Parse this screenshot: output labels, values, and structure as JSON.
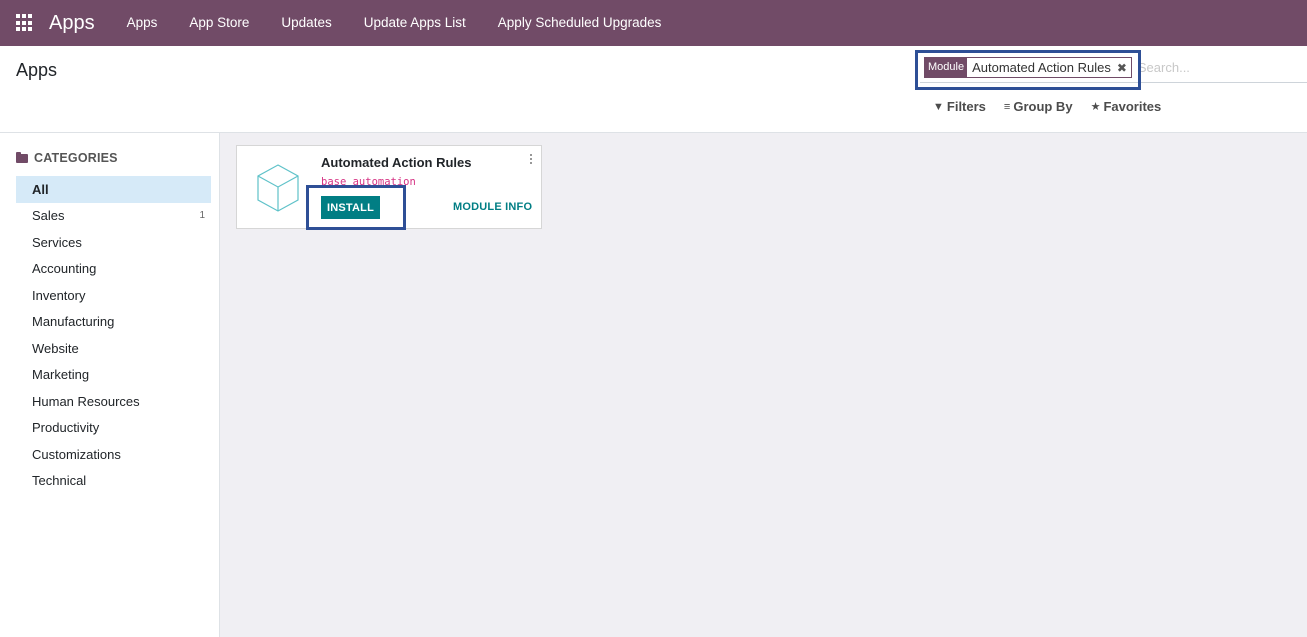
{
  "navbar": {
    "brand": "Apps",
    "items": [
      {
        "label": "Apps"
      },
      {
        "label": "App Store"
      },
      {
        "label": "Updates"
      },
      {
        "label": "Update Apps List"
      },
      {
        "label": "Apply Scheduled Upgrades"
      }
    ],
    "color": "#714b67"
  },
  "control_panel": {
    "title": "Apps",
    "search": {
      "facet_label": "Module",
      "facet_value": "Automated Action Rules",
      "placeholder": "Search..."
    },
    "filters": {
      "filters_label": "Filters",
      "group_by_label": "Group By",
      "favorites_label": "Favorites"
    }
  },
  "sidebar": {
    "header": "CATEGORIES",
    "items": [
      {
        "label": "All",
        "count": ""
      },
      {
        "label": "Sales",
        "count": "1"
      },
      {
        "label": "Services",
        "count": ""
      },
      {
        "label": "Accounting",
        "count": ""
      },
      {
        "label": "Inventory",
        "count": ""
      },
      {
        "label": "Manufacturing",
        "count": ""
      },
      {
        "label": "Website",
        "count": ""
      },
      {
        "label": "Marketing",
        "count": ""
      },
      {
        "label": "Human Resources",
        "count": ""
      },
      {
        "label": "Productivity",
        "count": ""
      },
      {
        "label": "Customizations",
        "count": ""
      },
      {
        "label": "Technical",
        "count": ""
      }
    ]
  },
  "card": {
    "title": "Automated Action Rules",
    "technical_name": "base_automation",
    "install_label": "INSTALL",
    "module_info_label": "MODULE INFO",
    "icon": "cube-icon"
  },
  "colors": {
    "accent": "#017e84",
    "brand": "#714b67",
    "highlight": "#2e4f96"
  }
}
